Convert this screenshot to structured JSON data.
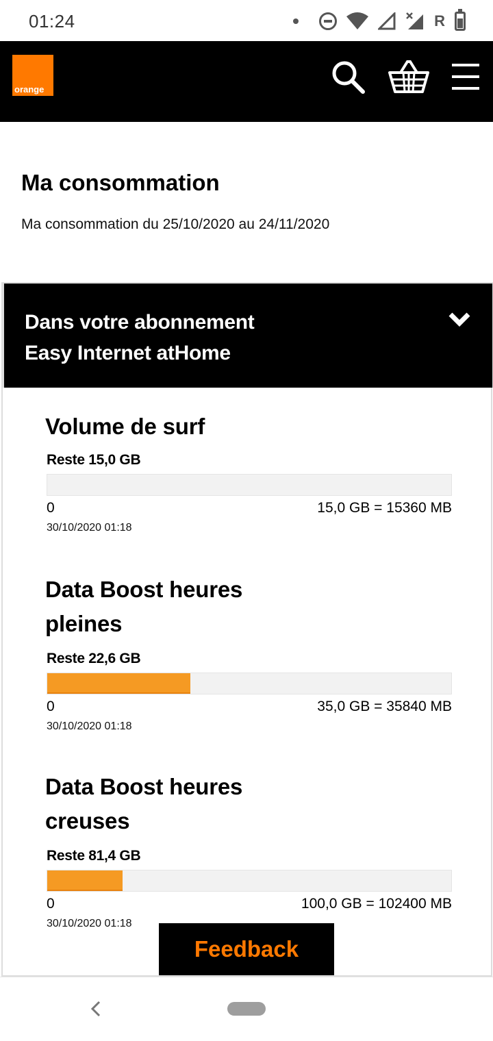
{
  "status_bar": {
    "time": "01:24",
    "roaming_label": "R",
    "icons": [
      "notification-dot-icon",
      "do-not-disturb-icon",
      "wifi-icon",
      "signal-icon",
      "signal-no-data-icon",
      "battery-icon"
    ]
  },
  "header": {
    "logo_text": "orange",
    "brand_color": "#ff7900",
    "icons": [
      "search-icon",
      "cart-icon",
      "menu-icon"
    ]
  },
  "page": {
    "title": "Ma consommation",
    "subtitle": "Ma consommation du 25/10/2020 au 24/11/2020"
  },
  "accordion": {
    "title_line1": "Dans votre abonnement",
    "title_line2": "Easy Internet atHome",
    "icon": "chevron-down-icon"
  },
  "usages": [
    {
      "title": "Volume de surf",
      "remaining": "Reste 15,0 GB",
      "used_fraction": 0.0,
      "min_label": "0",
      "max_label": "15,0 GB = 15360 MB",
      "timestamp": "30/10/2020 01:18"
    },
    {
      "title_line1": "Data Boost heures",
      "title_line2": "pleines",
      "remaining": "Reste 22,6 GB",
      "used_fraction": 0.354,
      "min_label": "0",
      "max_label": "35,0 GB = 35840 MB",
      "timestamp": "30/10/2020 01:18"
    },
    {
      "title_line1": "Data Boost heures",
      "title_line2": "creuses",
      "remaining": "Reste 81,4 GB",
      "used_fraction": 0.186,
      "min_label": "0",
      "max_label": "100,0 GB = 102400 MB",
      "timestamp": "30/10/2020 01:18"
    }
  ],
  "bar_color": "#f59a23",
  "feedback": {
    "label": "Feedback",
    "color": "#ff7900"
  },
  "navbar": {
    "icons": [
      "back-icon",
      "home-pill-icon"
    ]
  }
}
